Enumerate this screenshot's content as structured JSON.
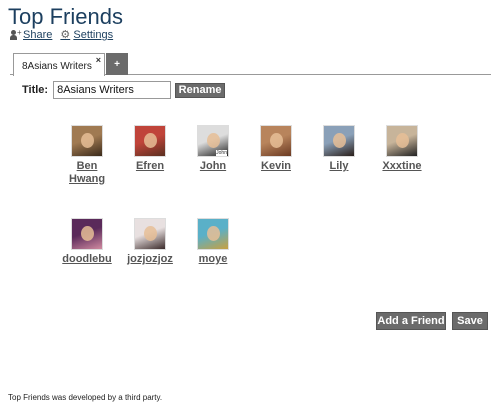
{
  "page": {
    "title": "Top Friends"
  },
  "actions": {
    "share": "Share",
    "settings": "Settings"
  },
  "tabs": {
    "active_label": "8Asians Writers",
    "close_glyph": "×",
    "add_glyph": "+"
  },
  "title_field": {
    "label": "Title:",
    "value": "8Asians Writers"
  },
  "buttons": {
    "rename": "Rename",
    "add_friend": "Add a Friend",
    "save": "Save"
  },
  "friends": [
    {
      "name": "Ben Hwang",
      "avatar_colors": [
        "#a07a52",
        "#3a2a1a"
      ]
    },
    {
      "name": "Efren",
      "avatar_colors": [
        "#c0443a",
        "#5a3020"
      ]
    },
    {
      "name": "John",
      "avatar_colors": [
        "#dddddd",
        "#222222"
      ],
      "avatar_caption": "John"
    },
    {
      "name": "Kevin",
      "avatar_colors": [
        "#b8845c",
        "#6b3a22"
      ]
    },
    {
      "name": "Lily",
      "avatar_colors": [
        "#8aa0b8",
        "#2a1f1a"
      ]
    },
    {
      "name": "Xxxtine",
      "avatar_colors": [
        "#c7b49a",
        "#222222"
      ]
    },
    {
      "name": "doodlebu",
      "avatar_colors": [
        "#5a2a5a",
        "#d08aa0"
      ]
    },
    {
      "name": "jozjozjoz",
      "avatar_colors": [
        "#e8e0e0",
        "#3a2a2a"
      ]
    },
    {
      "name": "moye",
      "avatar_colors": [
        "#5ab0c8",
        "#c8a040"
      ]
    }
  ],
  "footer": {
    "note": "Top Friends was developed by a third party."
  }
}
